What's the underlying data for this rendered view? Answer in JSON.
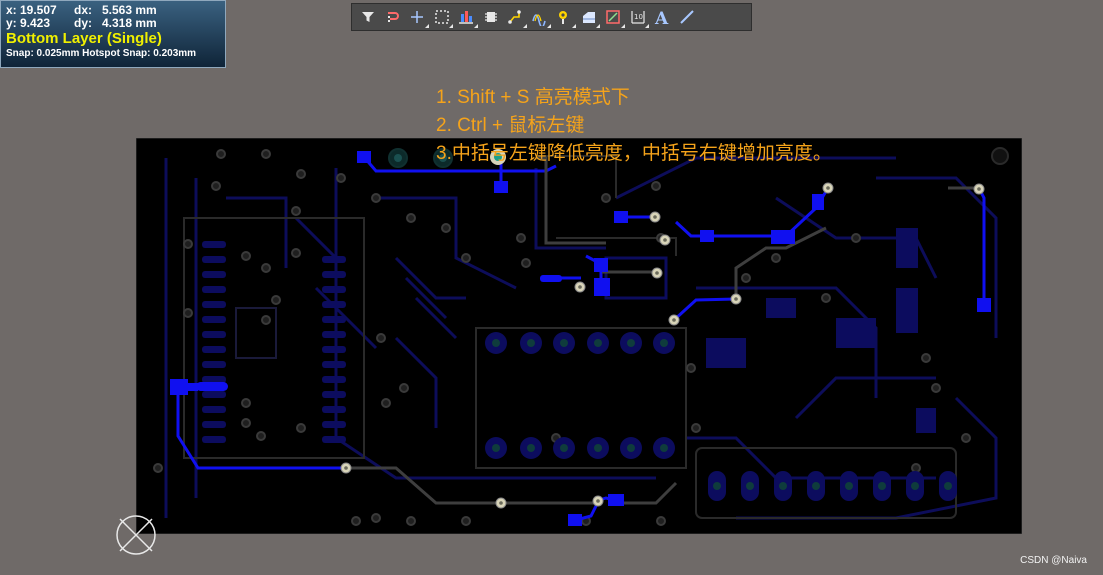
{
  "hud": {
    "x_label": "x:",
    "x_value": "19.507",
    "dx_label": "dx:",
    "dx_value": "5.563 mm",
    "y_label": "y:",
    "y_value": "9.423",
    "dy_label": "dy:",
    "dy_value": "4.318 mm",
    "layer": "Bottom Layer (Single)",
    "snap": "Snap: 0.025mm Hotspot Snap: 0.203mm"
  },
  "toolbar": {
    "tools": [
      {
        "icon": "filter-icon",
        "dropdown": false
      },
      {
        "icon": "interactive-route-icon",
        "dropdown": false
      },
      {
        "icon": "place-crosshair-icon",
        "dropdown": true
      },
      {
        "icon": "select-rect-icon",
        "dropdown": true
      },
      {
        "icon": "align-icon",
        "dropdown": true
      },
      {
        "icon": "component-icon",
        "dropdown": false
      },
      {
        "icon": "route-multiple-icon",
        "dropdown": true
      },
      {
        "icon": "diff-pair-icon",
        "dropdown": true
      },
      {
        "icon": "via-icon",
        "dropdown": true
      },
      {
        "icon": "polygon-icon",
        "dropdown": true
      },
      {
        "icon": "keepout-icon",
        "dropdown": true
      },
      {
        "icon": "dimension-icon",
        "dropdown": true
      },
      {
        "icon": "text-icon",
        "dropdown": false
      },
      {
        "icon": "line-icon",
        "dropdown": false
      }
    ]
  },
  "annotations": [
    "1. Shift + S 高亮模式下",
    "2. Ctrl + 鼠标左键",
    "3.中括号左键降低亮度，中括号右键增加亮度。"
  ],
  "watermark": "CSDN @Naiva",
  "colors": {
    "background": "#6f6a68",
    "board": "#000000",
    "highlighted_net": "#1010f0",
    "dimmed_copper": "#0c0c5e",
    "annotation_text": "#f5a31a",
    "hud_layer_text": "#f0f000"
  }
}
